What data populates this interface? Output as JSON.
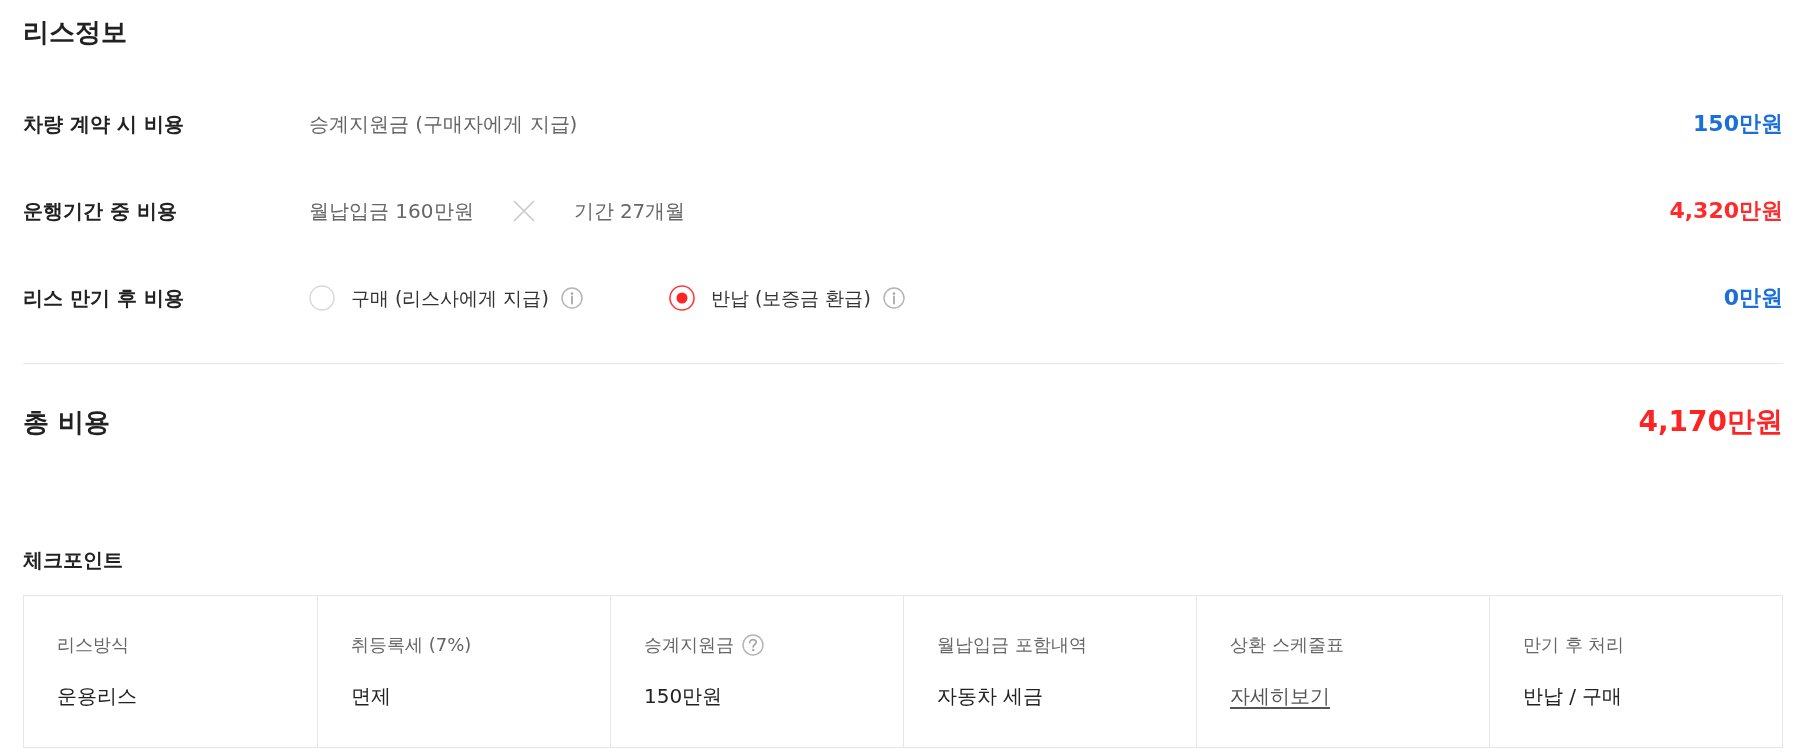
{
  "title": "리스정보",
  "cost_rows": [
    {
      "kind": "text",
      "label": "차량 계약 시 비용",
      "detail": "승계지원금 (구매자에게 지급)",
      "amount": "150만원",
      "color": "#1b6fd8"
    },
    {
      "kind": "product",
      "label": "운행기간 중 비용",
      "parts": [
        "월납입금 160만원",
        "기간 27개월"
      ],
      "amount": "4,320만원",
      "color": "#ff2b2b"
    },
    {
      "kind": "options",
      "label": "리스 만기 후 비용",
      "options": [
        {
          "label": "구매 (리스사에게 지급)",
          "selected": false
        },
        {
          "label": "반납 (보증금 환급)",
          "selected": true
        }
      ],
      "amount": "0만원",
      "color": "#1b6fd8"
    }
  ],
  "total": {
    "label": "총 비용",
    "amount": "4,170만원"
  },
  "checkpoints": {
    "title": "체크포인트",
    "items": [
      {
        "kind": "text",
        "label": "리스방식",
        "value": "운용리스"
      },
      {
        "kind": "text",
        "label": "취등록세 (7%)",
        "value": "면제"
      },
      {
        "kind": "help",
        "label": "승계지원금",
        "value": "150만원"
      },
      {
        "kind": "text",
        "label": "월납입금 포함내역",
        "value": "자동차 세금"
      },
      {
        "kind": "link",
        "label": "상환 스케줄표",
        "value": "자세히보기"
      },
      {
        "kind": "text",
        "label": "만기 후 처리",
        "value": "반납 / 구매"
      }
    ]
  }
}
